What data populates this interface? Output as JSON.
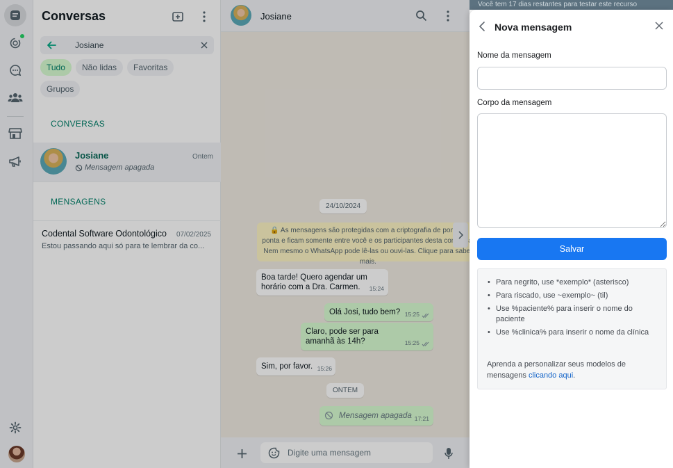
{
  "rail": {
    "icons": [
      "chats-icon",
      "status-icon",
      "channels-icon",
      "communities-icon",
      "store-icon",
      "megaphone-icon",
      "settings-icon"
    ]
  },
  "conversations": {
    "title": "Conversas",
    "search_value": "Josiane",
    "filters": [
      "Tudo",
      "Não lidas",
      "Favoritas",
      "Grupos"
    ],
    "section_conversations": "CONVERSAS",
    "section_messages": "MENSAGENS",
    "result": {
      "name": "Josiane",
      "time": "Ontem",
      "last_message": "Mensagem apagada"
    },
    "message_result": {
      "name": "Codental Software Odontológico",
      "date": "07/02/2025",
      "snippet": "Estou passando aqui só para te lembrar da co..."
    }
  },
  "chat": {
    "contact_name": "Josiane",
    "date_pill": "24/10/2024",
    "encryption_notice": "🔒 As mensagens são protegidas com a criptografia de ponta a ponta e ficam somente entre você e os participantes desta conversa. Nem mesmo o WhatsApp pode lê-las ou ouvi-las. Clique para saber mais.",
    "messages": [
      {
        "text": "Boa tarde! Quero agendar um horário com a Dra. Carmen.",
        "time": "15:24",
        "dir": "in"
      },
      {
        "text": "Olá Josi, tudo bem?",
        "time": "15:25",
        "dir": "out"
      },
      {
        "text": "Claro, pode ser para amanhã às 14h?",
        "time": "15:25",
        "dir": "out"
      },
      {
        "text": "Sim, por favor.",
        "time": "15:26",
        "dir": "in"
      },
      {
        "text": "Mensagem apagada",
        "time": "17:21",
        "dir": "out"
      }
    ],
    "day_pill": "ONTEM",
    "composer_placeholder": "Digite uma mensagem"
  },
  "banner": "Você tem 17 dias restantes para testar este recurso",
  "drawer": {
    "title": "Nova mensagem",
    "name_label": "Nome da mensagem",
    "name_value": "",
    "body_label": "Corpo da mensagem",
    "body_value": "",
    "save_label": "Salvar",
    "tips": [
      "Para negrito, use *exemplo* (asterisco)",
      "Para riscado, use ~exemplo~ (til)",
      "Use %paciente% para inserir o nome do paciente",
      "Use %clinica% para inserir o nome da clínica"
    ],
    "footer_text": "Aprenda a personalizar seus modelos de mensagens ",
    "footer_link": "clicando aqui",
    "footer_end": "."
  },
  "colors": {
    "accent_green": "#008069",
    "primary_blue": "#1877f2",
    "bubble_out": "#d9fdd3"
  }
}
